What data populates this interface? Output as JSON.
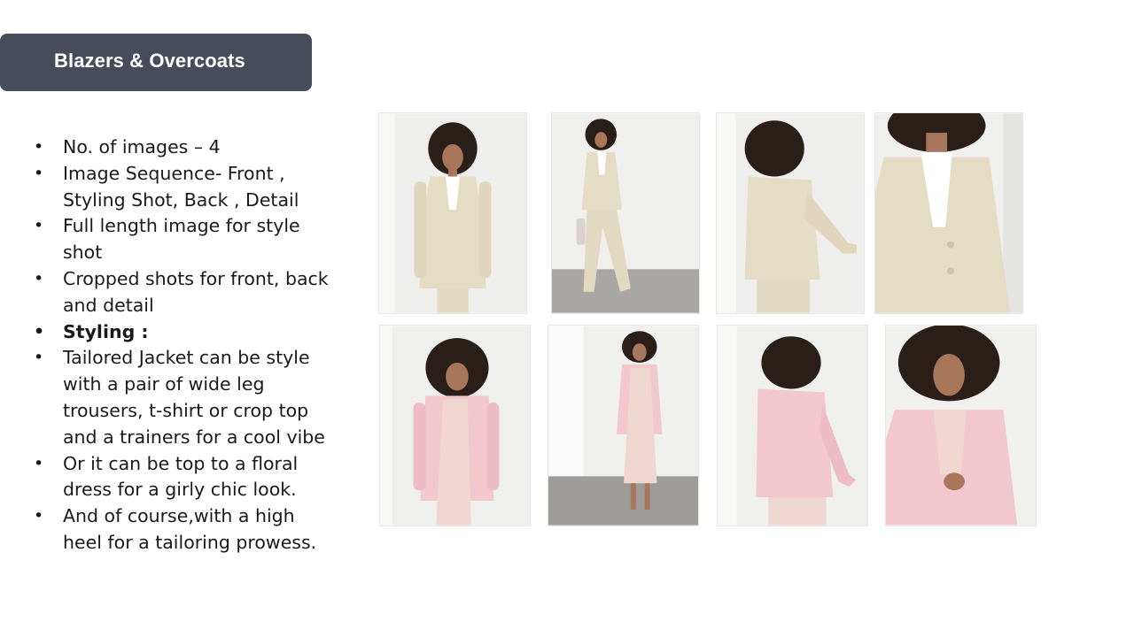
{
  "header": {
    "title": "Blazers & Overcoats"
  },
  "bullets": [
    {
      "text": "No. of images – 4",
      "bold": false
    },
    {
      "text": "Image Sequence- Front , Styling Shot, Back , Detail",
      "bold": false
    },
    {
      "text": "Full length image for style shot",
      "bold": false
    },
    {
      "text": "Cropped shots for front, back and detail",
      "bold": false
    },
    {
      "text": "Styling :",
      "bold": true
    },
    {
      "text": "Tailored Jacket can be style with a pair of wide leg trousers, t-shirt or crop top and a trainers for a cool vibe",
      "bold": false
    },
    {
      "text": "Or it can be top to a floral dress for a girly chic look.",
      "bold": false
    },
    {
      "text": "And of course,with a high heel for a tailoring prowess.",
      "bold": false
    }
  ],
  "gallery": {
    "colors": {
      "beige": "#e5dcc5",
      "pink": "#f2c7cd",
      "floral": "#efd6cf",
      "hair": "#2a1e18",
      "skin": "#a8765a"
    },
    "rows": [
      {
        "name": "beige-blazer",
        "shots": [
          "front",
          "styling",
          "back",
          "detail"
        ]
      },
      {
        "name": "pink-blazer",
        "shots": [
          "front",
          "styling",
          "back",
          "detail"
        ]
      }
    ]
  }
}
